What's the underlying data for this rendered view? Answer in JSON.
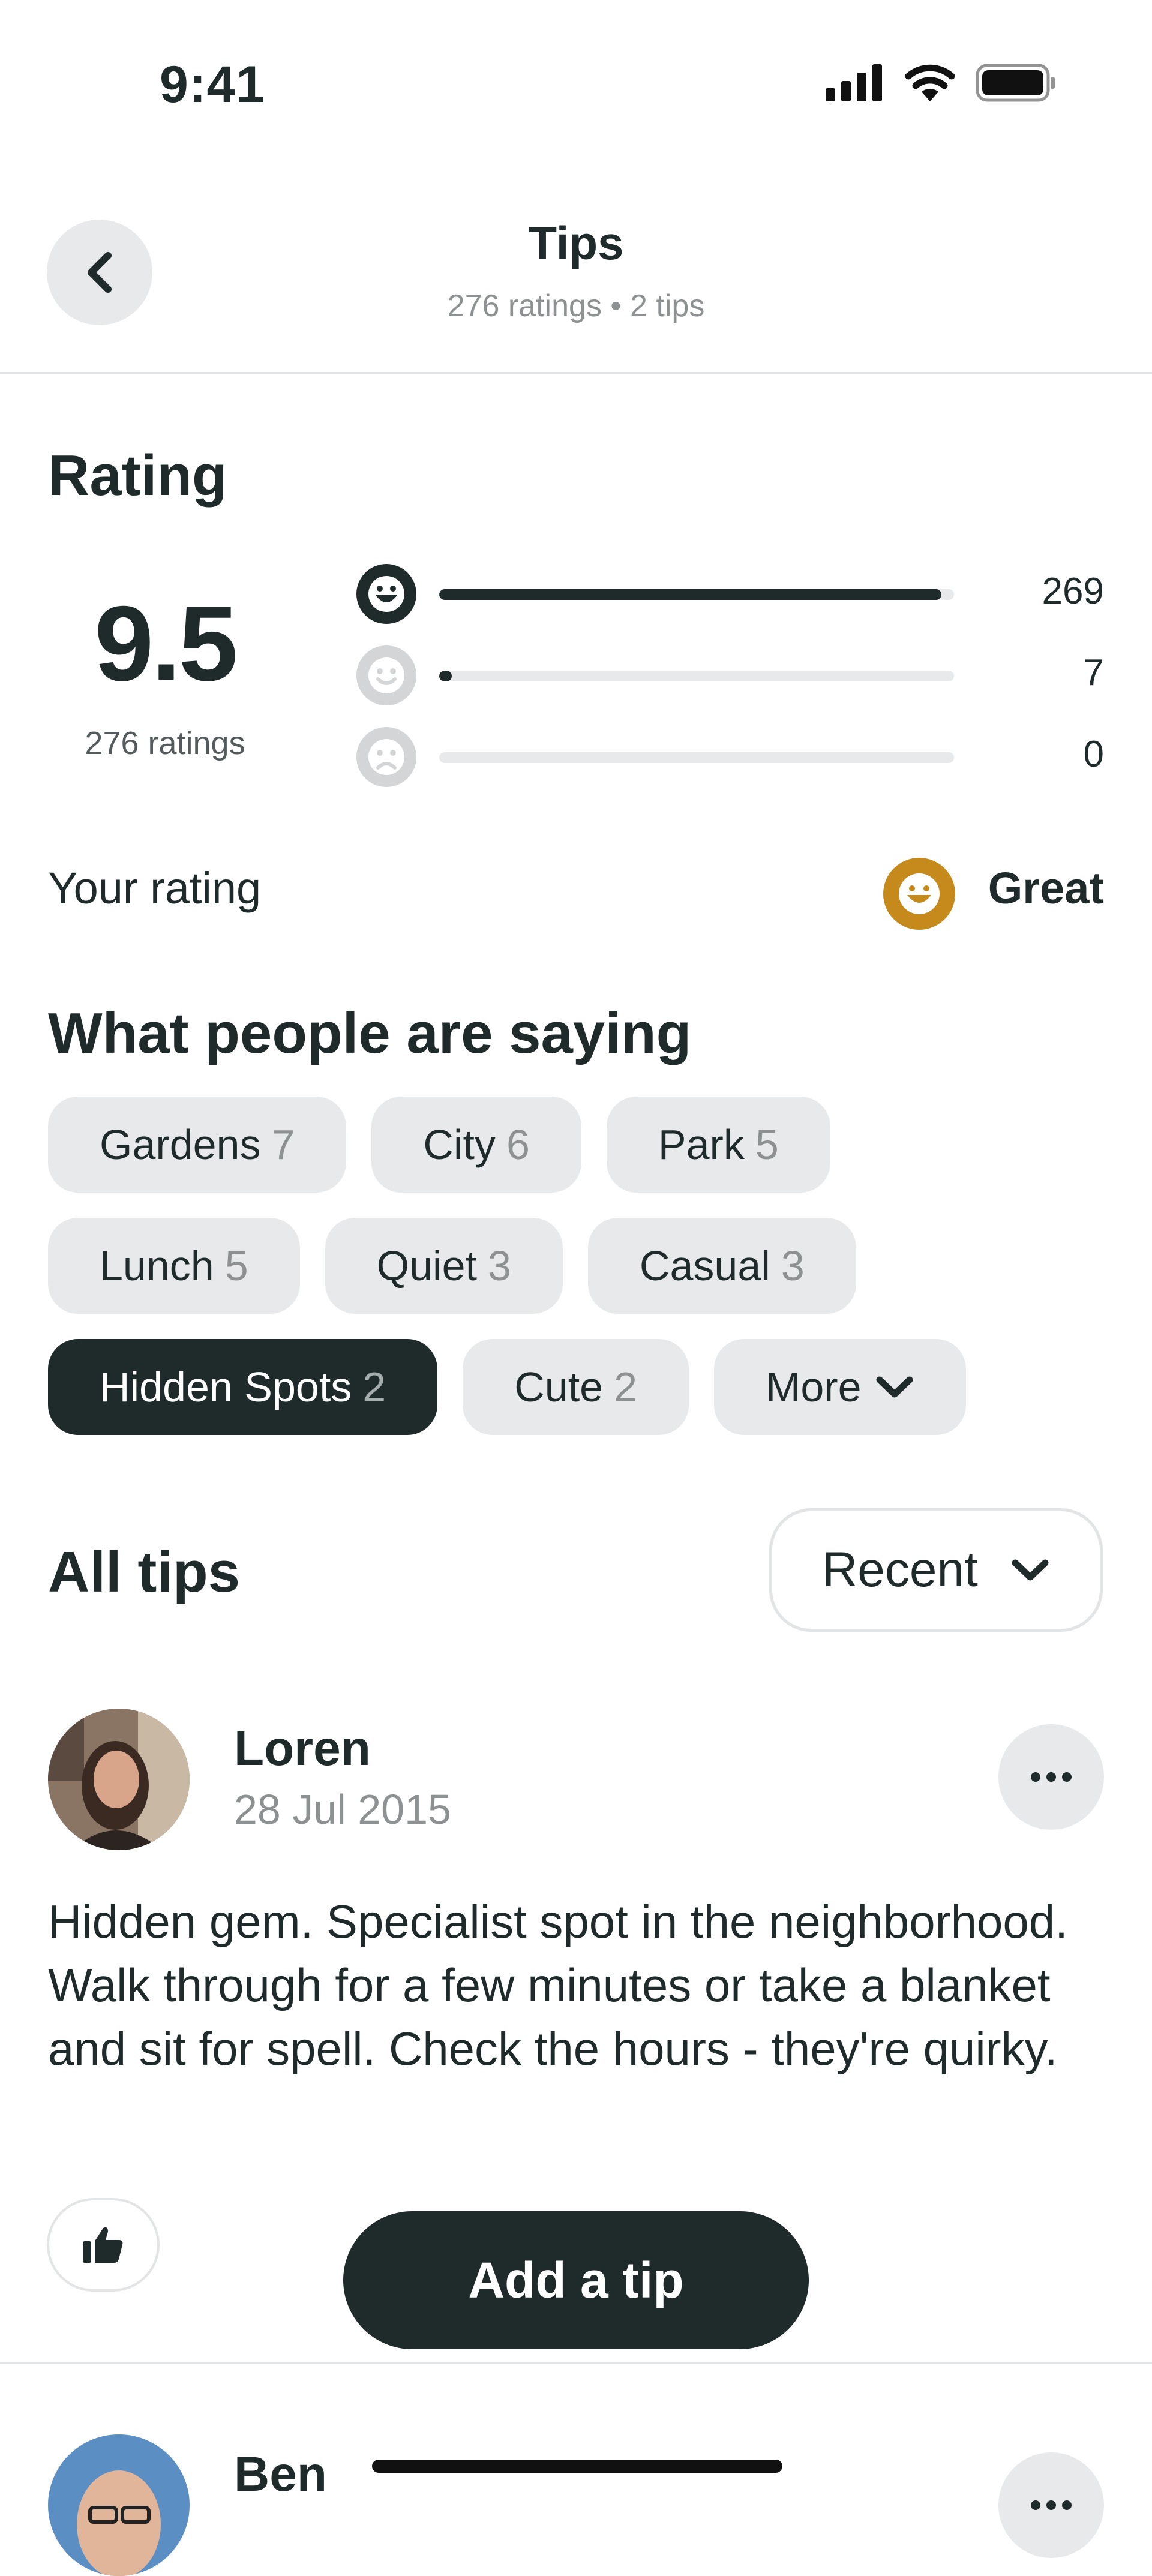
{
  "status_bar": {
    "time": "9:41",
    "icons": [
      "signal-icon",
      "wifi-icon",
      "battery-icon"
    ]
  },
  "header": {
    "title": "Tips",
    "subtitle": "276 ratings • 2 tips",
    "back_icon": "chevron-left-icon"
  },
  "rating": {
    "title": "Rating",
    "score": "9.5",
    "score_caption": "276 ratings",
    "rows": [
      {
        "icon": "grin-face-icon",
        "count": "269",
        "fraction": 0.975
      },
      {
        "icon": "smile-face-icon",
        "count": "7",
        "fraction": 0.025
      },
      {
        "icon": "sad-face-icon",
        "count": "0",
        "fraction": 0
      }
    ],
    "your_rating_label": "Your rating",
    "your_rating_value": "Great",
    "accent_color": "#c58a1b"
  },
  "saying": {
    "title": "What people are saying",
    "tags": [
      {
        "label": "Gardens",
        "count": "7",
        "active": false
      },
      {
        "label": "City",
        "count": "6",
        "active": false
      },
      {
        "label": "Park",
        "count": "5",
        "active": false
      },
      {
        "label": "Lunch",
        "count": "5",
        "active": false
      },
      {
        "label": "Quiet",
        "count": "3",
        "active": false
      },
      {
        "label": "Casual",
        "count": "3",
        "active": false
      },
      {
        "label": "Hidden Spots",
        "count": "2",
        "active": true
      },
      {
        "label": "Cute",
        "count": "2",
        "active": false
      }
    ],
    "more_label": "More"
  },
  "tips": {
    "title": "All tips",
    "sort_label": "Recent",
    "items": [
      {
        "name": "Loren",
        "date": "28 Jul 2015",
        "text": "Hidden gem. Specialist spot in the neighborhood. Walk through for a few minutes or take a blanket and sit for spell. Check the hours - they're quirky."
      },
      {
        "name": "Ben"
      }
    ],
    "add_tip_label": "Add a tip"
  },
  "colors": {
    "dark": "#1f2a2b",
    "chip_bg": "#e8e9ea",
    "muted": "#8d9191"
  }
}
